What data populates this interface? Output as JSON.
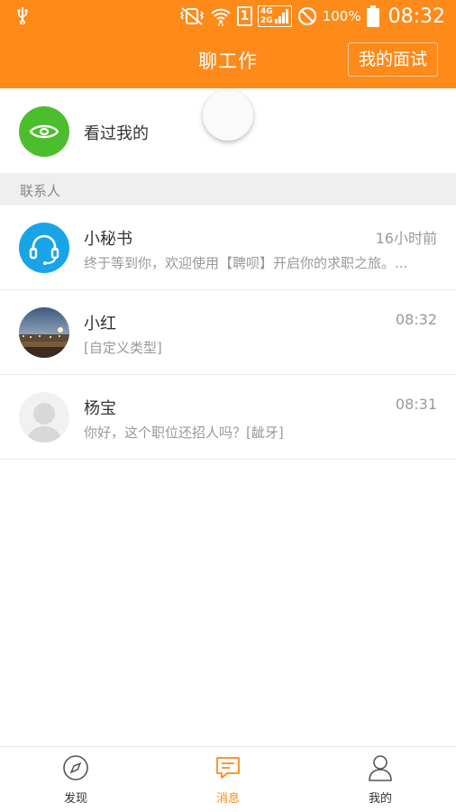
{
  "status_bar": {
    "battery": "100%",
    "time": "08:32",
    "network": [
      "4G",
      "2G"
    ],
    "sim": "1",
    "icons": [
      "usb-icon",
      "vibrate-icon",
      "wifi-icon",
      "sim-icon",
      "signal-icon",
      "do-not-disturb-icon",
      "battery-icon"
    ]
  },
  "header": {
    "title": "聊工作",
    "interview_button": "我的面试",
    "background_color": "#fd8a19"
  },
  "seen_me": {
    "label": "看过我的",
    "icon": "eye-icon",
    "icon_color": "#4bbe2e"
  },
  "contacts_section": {
    "title": "联系人",
    "items": [
      {
        "name": "小秘书",
        "time": "16小时前",
        "message": "终于等到你，欢迎使用【聘呗】开启你的求职之旅。...",
        "avatar": "headset-icon"
      },
      {
        "name": "小红",
        "time": "08:32",
        "message": "[自定义类型]",
        "avatar": "night-city-photo"
      },
      {
        "name": "杨宝",
        "time": "08:31",
        "message": "你好，这个职位还招人吗？[龇牙]",
        "avatar": "default-user-avatar"
      }
    ]
  },
  "tabbar": {
    "tabs": [
      {
        "label": "发现",
        "icon": "compass-icon",
        "active": false
      },
      {
        "label": "消息",
        "icon": "chat-icon",
        "active": true
      },
      {
        "label": "我的",
        "icon": "person-icon",
        "active": false
      }
    ],
    "active_color": "#fd8a19"
  }
}
